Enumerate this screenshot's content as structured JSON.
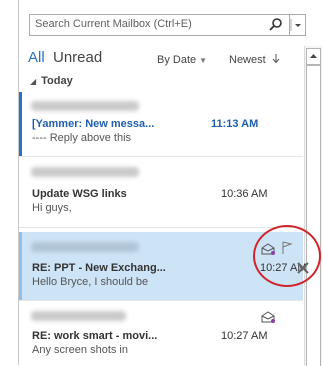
{
  "search": {
    "placeholder": "Search Current Mailbox (Ctrl+E)",
    "search_icon": "search-icon",
    "scope_icon": "chevron-down-icon"
  },
  "filters": {
    "all": "All",
    "unread": "Unread",
    "sort_by": "By Date",
    "order": "Newest"
  },
  "group": {
    "label": "Today"
  },
  "messages": [
    {
      "subject": "[Yammer: New messa...",
      "preview": "---- Reply above this",
      "time": "11:13 AM",
      "unread": true
    },
    {
      "subject": "Update WSG links",
      "preview": "Hi guys,",
      "time": "10:36 AM",
      "unread": false
    },
    {
      "subject": "RE: PPT - New Exchang...",
      "preview": "Hello Bryce,  I should be",
      "time": "10:27 AM",
      "unread": false,
      "selected": true
    },
    {
      "subject": "RE: work smart - movi...",
      "preview": "Any screen shots in",
      "time": "10:27 AM",
      "unread": false
    }
  ],
  "colors": {
    "accent": "#2a72c4",
    "selected_bg": "#cde3f6",
    "highlight": "#d0242c"
  }
}
